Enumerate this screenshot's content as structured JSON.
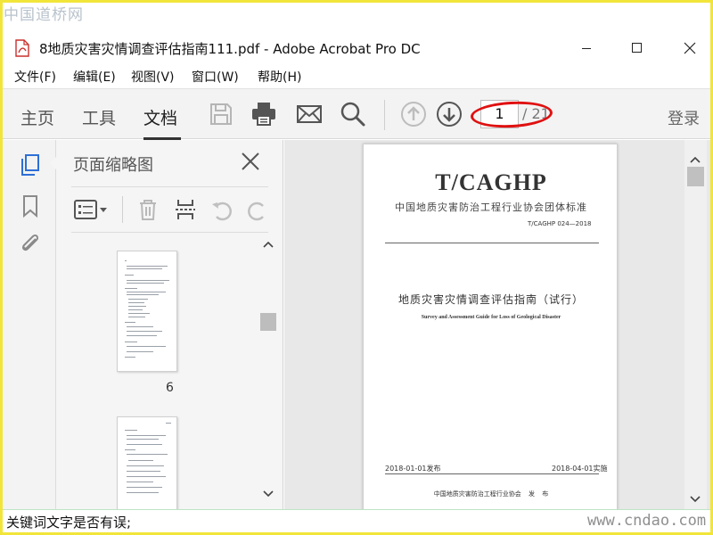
{
  "watermark": {
    "top": "中国道桥网",
    "bottom": "www.cndao.com"
  },
  "window": {
    "title": "8地质灾害灾情调查评估指南111.pdf - Adobe Acrobat Pro DC"
  },
  "menu": [
    {
      "label": "文件(F)"
    },
    {
      "label": "编辑(E)"
    },
    {
      "label": "视图(V)"
    },
    {
      "label": "窗口(W)"
    },
    {
      "label": "帮助(H)"
    }
  ],
  "toolbar": {
    "tabs": [
      {
        "label": "主页"
      },
      {
        "label": "工具"
      },
      {
        "label": "文档"
      }
    ],
    "active_tab": "文档",
    "page_current": "1",
    "page_total": "/ 21",
    "login_label": "登录",
    "highlight_color": "#e01010"
  },
  "thumbnail_panel": {
    "title": "页面缩略图",
    "pages": [
      {
        "label": "6"
      }
    ]
  },
  "document": {
    "logo": "T/CAGHP",
    "org": "中国地质灾害防治工程行业协会团体标准",
    "code": "T/CAGHP 024—2018",
    "title": "地质灾害灾情调查评估指南（试行）",
    "subtitle": "Survey and Assessment Guide for Loss of Geological Disaster",
    "date_issue": "2018-01-01发布",
    "date_effective": "2018-04-01实施",
    "publisher": "中国地质灾害防治工程行业协会 发 布"
  },
  "bottom_caption": "关键词文字是否有误;"
}
